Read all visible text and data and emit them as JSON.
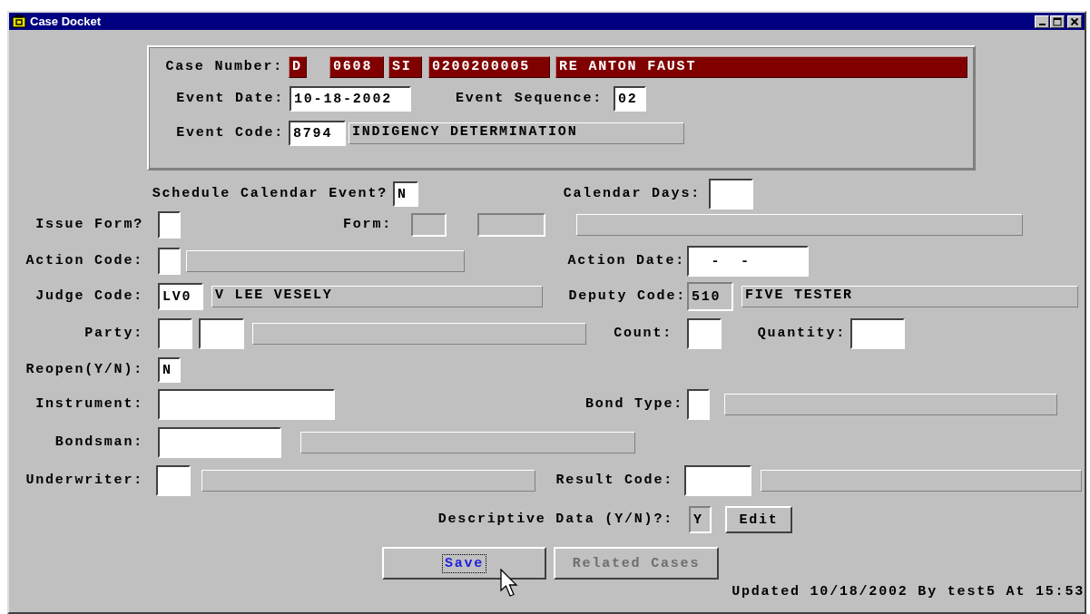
{
  "window": {
    "title": "Case Docket"
  },
  "case_header": {
    "rows": [
      {
        "items": [
          {
            "kind": "label",
            "text": "Case Number:"
          },
          {
            "kind": "case-box",
            "text": "D"
          },
          {
            "kind": "case-box",
            "text": "0608"
          },
          {
            "kind": "case-box",
            "text": "SI"
          },
          {
            "kind": "case-box",
            "text": "0200200005"
          },
          {
            "kind": "case-box",
            "text": "RE ANTON FAUST"
          }
        ]
      },
      {
        "items": [
          {
            "kind": "label",
            "text": "Event Date:"
          },
          {
            "kind": "input",
            "value": "10-18-2002",
            "disabled": false
          },
          {
            "kind": "label",
            "text": "Event Sequence:"
          },
          {
            "kind": "input",
            "value": "02",
            "disabled": false
          }
        ]
      },
      {
        "items": [
          {
            "kind": "label",
            "text": "Event Code:"
          },
          {
            "kind": "input",
            "value": "8794",
            "disabled": false
          },
          {
            "kind": "description",
            "text": "INDIGENCY DETERMINATION"
          }
        ]
      }
    ]
  },
  "form": {
    "rows": [
      {
        "items": [
          {
            "kind": "label",
            "text": "Schedule Calendar Event?"
          },
          {
            "kind": "input",
            "value": "N",
            "disabled": false
          },
          {
            "kind": "label",
            "text": "Calendar Days:"
          },
          {
            "kind": "input",
            "disabled": false
          }
        ]
      },
      {
        "items": [
          {
            "kind": "label",
            "text": "Issue Form?"
          },
          {
            "kind": "input",
            "disabled": false
          },
          {
            "kind": "label",
            "text": "Form:"
          },
          {
            "kind": "input",
            "disabled": true
          },
          {
            "kind": "input",
            "disabled": true
          },
          {
            "kind": "description"
          }
        ]
      },
      {
        "items": [
          {
            "kind": "label",
            "text": "Action Code:"
          },
          {
            "kind": "input",
            "disabled": false
          },
          {
            "kind": "description"
          },
          {
            "kind": "label",
            "text": "Action Date:"
          },
          {
            "kind": "input",
            "value": "  -  -",
            "disabled": false
          }
        ]
      },
      {
        "items": [
          {
            "kind": "label",
            "text": "Judge Code:"
          },
          {
            "kind": "input",
            "value": "LV0",
            "disabled": false
          },
          {
            "kind": "description",
            "text": "V LEE VESELY"
          },
          {
            "kind": "label",
            "text": "Deputy Code:"
          },
          {
            "kind": "input",
            "value": "510",
            "disabled": true
          },
          {
            "kind": "description",
            "text": "FIVE TESTER"
          }
        ]
      },
      {
        "items": [
          {
            "kind": "label",
            "text": "Party:"
          },
          {
            "kind": "input",
            "disabled": false
          },
          {
            "kind": "input",
            "disabled": false
          },
          {
            "kind": "description"
          },
          {
            "kind": "label",
            "text": "Count:"
          },
          {
            "kind": "input",
            "disabled": false
          },
          {
            "kind": "label",
            "text": "Quantity:"
          },
          {
            "kind": "input",
            "disabled": false
          }
        ]
      },
      {
        "items": [
          {
            "kind": "label",
            "text": "Reopen(Y/N):"
          },
          {
            "kind": "input",
            "value": "N",
            "disabled": false
          }
        ]
      },
      {
        "items": [
          {
            "kind": "label",
            "text": "Instrument:"
          },
          {
            "kind": "input",
            "disabled": false
          },
          {
            "kind": "label",
            "text": "Bond Type:"
          },
          {
            "kind": "input",
            "disabled": false
          },
          {
            "kind": "description"
          }
        ]
      },
      {
        "items": [
          {
            "kind": "label",
            "text": "Bondsman:"
          },
          {
            "kind": "input",
            "disabled": false
          },
          {
            "kind": "description"
          }
        ]
      },
      {
        "items": [
          {
            "kind": "label",
            "text": "Underwriter:"
          },
          {
            "kind": "input",
            "disabled": false
          },
          {
            "kind": "description"
          },
          {
            "kind": "label",
            "text": "Result Code:"
          },
          {
            "kind": "input",
            "disabled": false
          },
          {
            "kind": "description"
          }
        ]
      },
      {
        "items": [
          {
            "kind": "label",
            "text": "Descriptive Data (Y/N)?:"
          },
          {
            "kind": "input",
            "value": "Y",
            "disabled": true
          },
          {
            "kind": "button",
            "label": "Edit",
            "disabled": false,
            "focused": false
          }
        ]
      },
      {
        "items": [
          {
            "kind": "button",
            "label": "Save",
            "disabled": false,
            "focused": true
          },
          {
            "kind": "button",
            "label": "Related Cases",
            "disabled": true,
            "focused": false
          }
        ]
      },
      {
        "items": [
          {
            "kind": "status",
            "text": "Updated 10/18/2002 By test5 At 15:53"
          }
        ]
      }
    ]
  }
}
